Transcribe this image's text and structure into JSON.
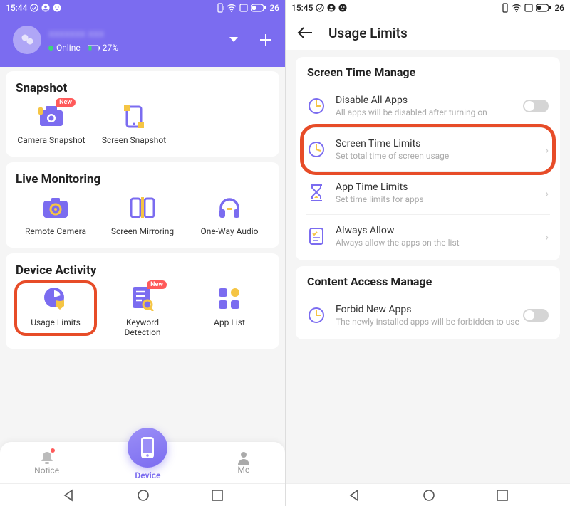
{
  "left": {
    "status": {
      "time": "15:44",
      "battery": "26"
    },
    "header": {
      "username": "xxxxxxx xxx",
      "online": "Online",
      "battery_pct": "27%"
    },
    "sections": {
      "snapshot": {
        "title": "Snapshot",
        "items": [
          {
            "label": "Camera Snapshot",
            "badge": "New"
          },
          {
            "label": "Screen Snapshot"
          }
        ]
      },
      "live": {
        "title": "Live Monitoring",
        "items": [
          {
            "label": "Remote Camera"
          },
          {
            "label": "Screen Mirroring"
          },
          {
            "label": "One-Way Audio"
          }
        ]
      },
      "activity": {
        "title": "Device Activity",
        "items": [
          {
            "label": "Usage Limits"
          },
          {
            "label": "Keyword Detection",
            "badge": "New"
          },
          {
            "label": "App List"
          }
        ]
      }
    },
    "nav": {
      "notice": "Notice",
      "device": "Device",
      "me": "Me"
    }
  },
  "right": {
    "status": {
      "time": "15:45",
      "battery": "26"
    },
    "title": "Usage Limits",
    "screen_time": {
      "title": "Screen Time Manage",
      "items": [
        {
          "title": "Disable All Apps",
          "sub": "All apps will be disabled after turning on"
        },
        {
          "title": "Screen Time Limits",
          "sub": "Set total time of screen usage"
        },
        {
          "title": "App Time Limits",
          "sub": "Set time limits for apps"
        },
        {
          "title": "Always Allow",
          "sub": "Always allow the apps on the list"
        }
      ]
    },
    "content_access": {
      "title": "Content Access Manage",
      "items": [
        {
          "title": "Forbid New Apps",
          "sub": "The newly installed apps will be forbidden to use"
        }
      ]
    }
  }
}
